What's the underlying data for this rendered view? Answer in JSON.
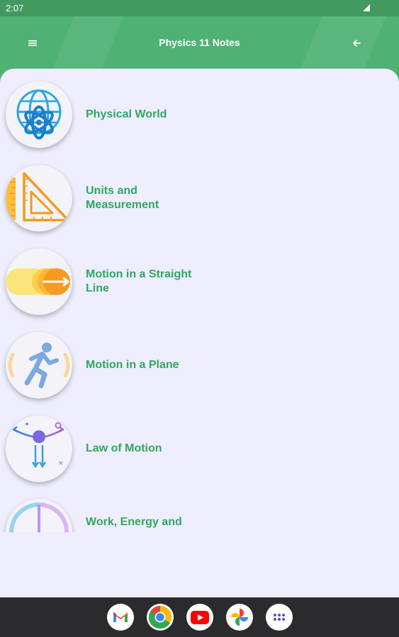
{
  "status_bar": {
    "time": "2:07"
  },
  "app_bar": {
    "title": "Physics 11 Notes"
  },
  "chapters": [
    {
      "title": "Physical World",
      "icon": "globe-atom-icon"
    },
    {
      "title": "Units and Measurement",
      "icon": "ruler-set-square-icon"
    },
    {
      "title": "Motion in a Straight Line",
      "icon": "arrow-motion-icon"
    },
    {
      "title": "Motion in a Plane",
      "icon": "running-person-icon"
    },
    {
      "title": "Law of Motion",
      "icon": "force-arrows-icon"
    },
    {
      "title": "Work, Energy and",
      "icon": "energy-icon"
    }
  ],
  "dock_apps": [
    "gmail",
    "chrome",
    "youtube",
    "photos",
    "app-drawer"
  ],
  "colors": {
    "app_bar": "#4fb274",
    "status_bar": "#41995f",
    "accent_text": "#2fa860",
    "sheet": "#efeefe"
  }
}
